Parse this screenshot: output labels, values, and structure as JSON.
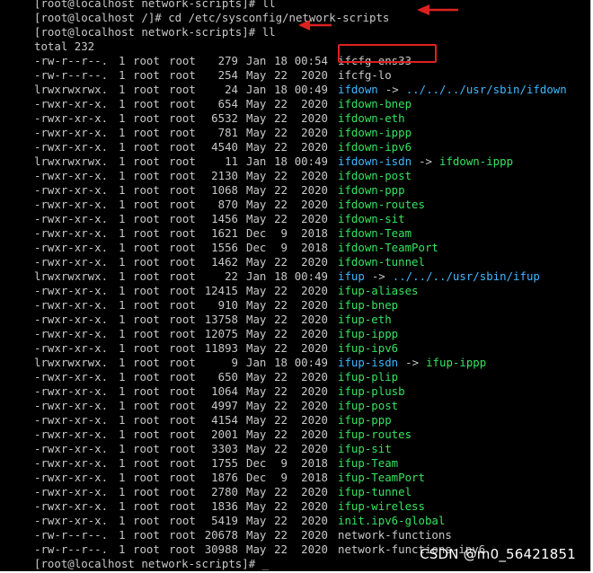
{
  "terminal": {
    "top_partial": "[root@localhost network-scripts]# ll",
    "cmd1_prompt": "[root@localhost /]#",
    "cmd1_text": " cd /etc/sysconfig/network-scripts",
    "cmd2_prompt": "[root@localhost network-scripts]#",
    "cmd2_text": " ll",
    "total": "total 232",
    "final_prompt": "[root@localhost network-scripts]#",
    "cursor": "_"
  },
  "files": [
    {
      "perm": "-rw-r--r--.",
      "links": "1",
      "owner": "root",
      "group": "root",
      "size": "279",
      "month": "Jan",
      "day": "18",
      "time": "00:54",
      "name": "ifcfg-ens33",
      "kind": "plain",
      "target": ""
    },
    {
      "perm": "-rw-r--r--.",
      "links": "1",
      "owner": "root",
      "group": "root",
      "size": "254",
      "month": "May",
      "day": "22",
      "time": "2020",
      "name": "ifcfg-lo",
      "kind": "plain",
      "target": ""
    },
    {
      "perm": "lrwxrwxrwx.",
      "links": "1",
      "owner": "root",
      "group": "root",
      "size": "24",
      "month": "Jan",
      "day": "18",
      "time": "00:49",
      "name": "ifdown",
      "kind": "link",
      "target": "../../../usr/sbin/ifdown"
    },
    {
      "perm": "-rwxr-xr-x.",
      "links": "1",
      "owner": "root",
      "group": "root",
      "size": "654",
      "month": "May",
      "day": "22",
      "time": "2020",
      "name": "ifdown-bnep",
      "kind": "exec",
      "target": ""
    },
    {
      "perm": "-rwxr-xr-x.",
      "links": "1",
      "owner": "root",
      "group": "root",
      "size": "6532",
      "month": "May",
      "day": "22",
      "time": "2020",
      "name": "ifdown-eth",
      "kind": "exec",
      "target": ""
    },
    {
      "perm": "-rwxr-xr-x.",
      "links": "1",
      "owner": "root",
      "group": "root",
      "size": "781",
      "month": "May",
      "day": "22",
      "time": "2020",
      "name": "ifdown-ippp",
      "kind": "exec",
      "target": ""
    },
    {
      "perm": "-rwxr-xr-x.",
      "links": "1",
      "owner": "root",
      "group": "root",
      "size": "4540",
      "month": "May",
      "day": "22",
      "time": "2020",
      "name": "ifdown-ipv6",
      "kind": "exec",
      "target": ""
    },
    {
      "perm": "lrwxrwxrwx.",
      "links": "1",
      "owner": "root",
      "group": "root",
      "size": "11",
      "month": "Jan",
      "day": "18",
      "time": "00:49",
      "name": "ifdown-isdn",
      "kind": "link",
      "target": "ifdown-ippp"
    },
    {
      "perm": "-rwxr-xr-x.",
      "links": "1",
      "owner": "root",
      "group": "root",
      "size": "2130",
      "month": "May",
      "day": "22",
      "time": "2020",
      "name": "ifdown-post",
      "kind": "exec",
      "target": ""
    },
    {
      "perm": "-rwxr-xr-x.",
      "links": "1",
      "owner": "root",
      "group": "root",
      "size": "1068",
      "month": "May",
      "day": "22",
      "time": "2020",
      "name": "ifdown-ppp",
      "kind": "exec",
      "target": ""
    },
    {
      "perm": "-rwxr-xr-x.",
      "links": "1",
      "owner": "root",
      "group": "root",
      "size": "870",
      "month": "May",
      "day": "22",
      "time": "2020",
      "name": "ifdown-routes",
      "kind": "exec",
      "target": ""
    },
    {
      "perm": "-rwxr-xr-x.",
      "links": "1",
      "owner": "root",
      "group": "root",
      "size": "1456",
      "month": "May",
      "day": "22",
      "time": "2020",
      "name": "ifdown-sit",
      "kind": "exec",
      "target": ""
    },
    {
      "perm": "-rwxr-xr-x.",
      "links": "1",
      "owner": "root",
      "group": "root",
      "size": "1621",
      "month": "Dec",
      "day": "9",
      "time": "2018",
      "name": "ifdown-Team",
      "kind": "exec",
      "target": ""
    },
    {
      "perm": "-rwxr-xr-x.",
      "links": "1",
      "owner": "root",
      "group": "root",
      "size": "1556",
      "month": "Dec",
      "day": "9",
      "time": "2018",
      "name": "ifdown-TeamPort",
      "kind": "exec",
      "target": ""
    },
    {
      "perm": "-rwxr-xr-x.",
      "links": "1",
      "owner": "root",
      "group": "root",
      "size": "1462",
      "month": "May",
      "day": "22",
      "time": "2020",
      "name": "ifdown-tunnel",
      "kind": "exec",
      "target": ""
    },
    {
      "perm": "lrwxrwxrwx.",
      "links": "1",
      "owner": "root",
      "group": "root",
      "size": "22",
      "month": "Jan",
      "day": "18",
      "time": "00:49",
      "name": "ifup",
      "kind": "link",
      "target": "../../../usr/sbin/ifup"
    },
    {
      "perm": "-rwxr-xr-x.",
      "links": "1",
      "owner": "root",
      "group": "root",
      "size": "12415",
      "month": "May",
      "day": "22",
      "time": "2020",
      "name": "ifup-aliases",
      "kind": "exec",
      "target": ""
    },
    {
      "perm": "-rwxr-xr-x.",
      "links": "1",
      "owner": "root",
      "group": "root",
      "size": "910",
      "month": "May",
      "day": "22",
      "time": "2020",
      "name": "ifup-bnep",
      "kind": "exec",
      "target": ""
    },
    {
      "perm": "-rwxr-xr-x.",
      "links": "1",
      "owner": "root",
      "group": "root",
      "size": "13758",
      "month": "May",
      "day": "22",
      "time": "2020",
      "name": "ifup-eth",
      "kind": "exec",
      "target": ""
    },
    {
      "perm": "-rwxr-xr-x.",
      "links": "1",
      "owner": "root",
      "group": "root",
      "size": "12075",
      "month": "May",
      "day": "22",
      "time": "2020",
      "name": "ifup-ippp",
      "kind": "exec",
      "target": ""
    },
    {
      "perm": "-rwxr-xr-x.",
      "links": "1",
      "owner": "root",
      "group": "root",
      "size": "11893",
      "month": "May",
      "day": "22",
      "time": "2020",
      "name": "ifup-ipv6",
      "kind": "exec",
      "target": ""
    },
    {
      "perm": "lrwxrwxrwx.",
      "links": "1",
      "owner": "root",
      "group": "root",
      "size": "9",
      "month": "Jan",
      "day": "18",
      "time": "00:49",
      "name": "ifup-isdn",
      "kind": "link",
      "target": "ifup-ippp"
    },
    {
      "perm": "-rwxr-xr-x.",
      "links": "1",
      "owner": "root",
      "group": "root",
      "size": "650",
      "month": "May",
      "day": "22",
      "time": "2020",
      "name": "ifup-plip",
      "kind": "exec",
      "target": ""
    },
    {
      "perm": "-rwxr-xr-x.",
      "links": "1",
      "owner": "root",
      "group": "root",
      "size": "1064",
      "month": "May",
      "day": "22",
      "time": "2020",
      "name": "ifup-plusb",
      "kind": "exec",
      "target": ""
    },
    {
      "perm": "-rwxr-xr-x.",
      "links": "1",
      "owner": "root",
      "group": "root",
      "size": "4997",
      "month": "May",
      "day": "22",
      "time": "2020",
      "name": "ifup-post",
      "kind": "exec",
      "target": ""
    },
    {
      "perm": "-rwxr-xr-x.",
      "links": "1",
      "owner": "root",
      "group": "root",
      "size": "4154",
      "month": "May",
      "day": "22",
      "time": "2020",
      "name": "ifup-ppp",
      "kind": "exec",
      "target": ""
    },
    {
      "perm": "-rwxr-xr-x.",
      "links": "1",
      "owner": "root",
      "group": "root",
      "size": "2001",
      "month": "May",
      "day": "22",
      "time": "2020",
      "name": "ifup-routes",
      "kind": "exec",
      "target": ""
    },
    {
      "perm": "-rwxr-xr-x.",
      "links": "1",
      "owner": "root",
      "group": "root",
      "size": "3303",
      "month": "May",
      "day": "22",
      "time": "2020",
      "name": "ifup-sit",
      "kind": "exec",
      "target": ""
    },
    {
      "perm": "-rwxr-xr-x.",
      "links": "1",
      "owner": "root",
      "group": "root",
      "size": "1755",
      "month": "Dec",
      "day": "9",
      "time": "2018",
      "name": "ifup-Team",
      "kind": "exec",
      "target": ""
    },
    {
      "perm": "-rwxr-xr-x.",
      "links": "1",
      "owner": "root",
      "group": "root",
      "size": "1876",
      "month": "Dec",
      "day": "9",
      "time": "2018",
      "name": "ifup-TeamPort",
      "kind": "exec",
      "target": ""
    },
    {
      "perm": "-rwxr-xr-x.",
      "links": "1",
      "owner": "root",
      "group": "root",
      "size": "2780",
      "month": "May",
      "day": "22",
      "time": "2020",
      "name": "ifup-tunnel",
      "kind": "exec",
      "target": ""
    },
    {
      "perm": "-rwxr-xr-x.",
      "links": "1",
      "owner": "root",
      "group": "root",
      "size": "1836",
      "month": "May",
      "day": "22",
      "time": "2020",
      "name": "ifup-wireless",
      "kind": "exec",
      "target": ""
    },
    {
      "perm": "-rwxr-xr-x.",
      "links": "1",
      "owner": "root",
      "group": "root",
      "size": "5419",
      "month": "May",
      "day": "22",
      "time": "2020",
      "name": "init.ipv6-global",
      "kind": "exec",
      "target": ""
    },
    {
      "perm": "-rw-r--r--.",
      "links": "1",
      "owner": "root",
      "group": "root",
      "size": "20678",
      "month": "May",
      "day": "22",
      "time": "2020",
      "name": "network-functions",
      "kind": "plain",
      "target": ""
    },
    {
      "perm": "-rw-r--r--.",
      "links": "1",
      "owner": "root",
      "group": "root",
      "size": "30988",
      "month": "May",
      "day": "22",
      "time": "2020",
      "name": "network-functions-ipv6",
      "kind": "plain",
      "target": ""
    }
  ],
  "link_arrow": "->",
  "colors": {
    "background": "#000000",
    "text": "#c8c8c8",
    "executable": "#35e35e",
    "symlink": "#3fb8ff",
    "annotation": "#e02020"
  },
  "annotations": {
    "highlighted_file": "ifcfg-ens33",
    "icons": [
      "red-arrow-icon"
    ]
  },
  "watermark": "CSDN @m0_56421851"
}
